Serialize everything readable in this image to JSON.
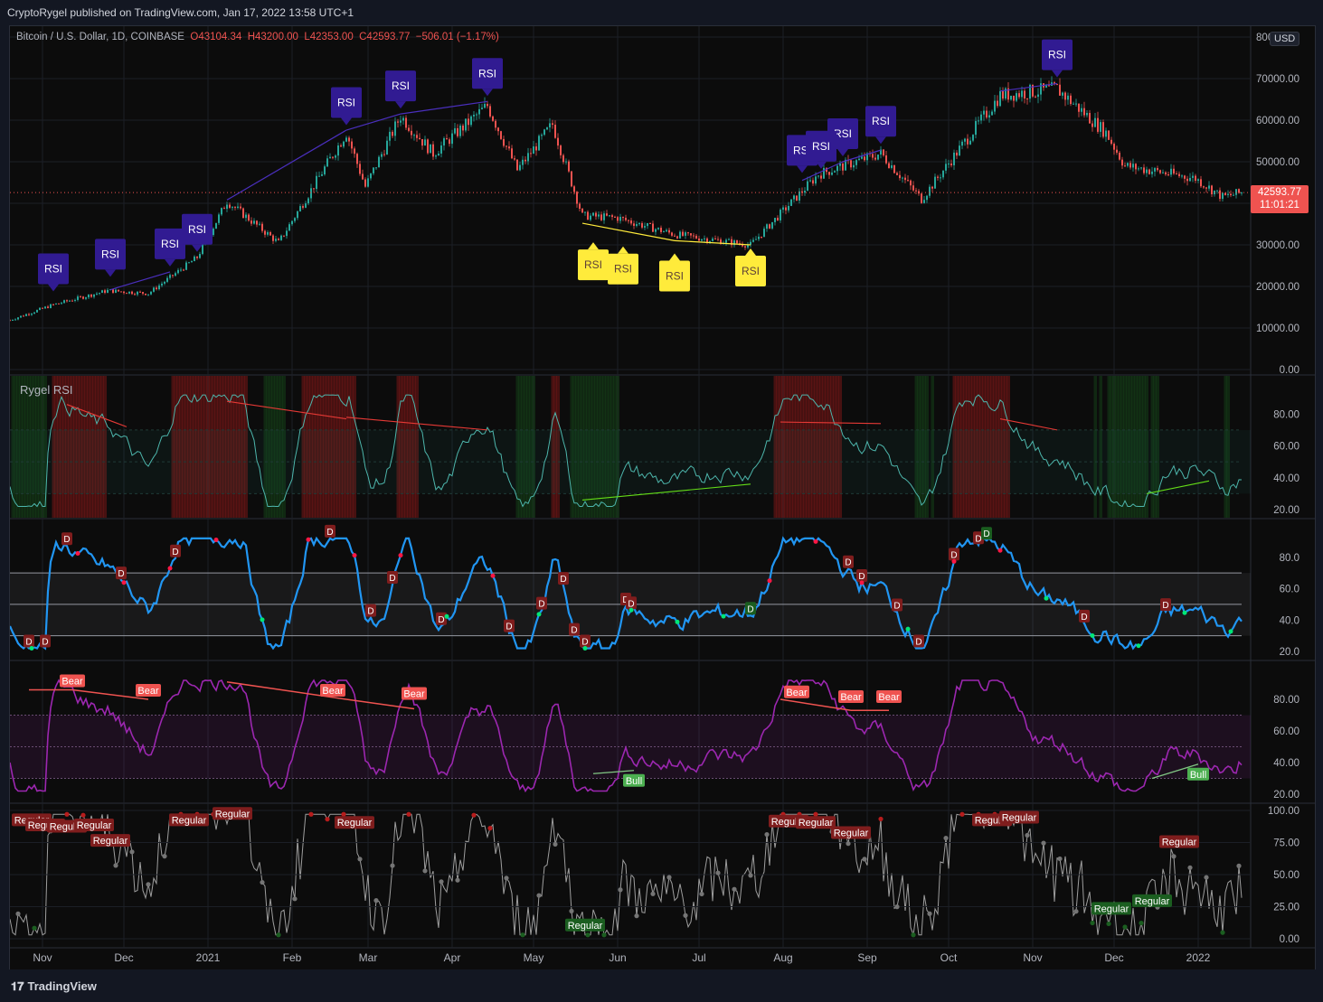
{
  "header": {
    "published": "CryptoRygel published on TradingView.com, Jan 17, 2022 13:58 UTC+1"
  },
  "footer": {
    "brand": "TradingView",
    "brand_icon": "tradingview-logo-icon"
  },
  "legend": {
    "symbol": "Bitcoin / U.S. Dollar, 1D, COINBASE",
    "open": "O43104.34",
    "high": "H43200.00",
    "low": "L42353.00",
    "close": "C42593.77",
    "change": "−506.01 (−1.17%)"
  },
  "price_axis": {
    "currency": "USD",
    "last_price": "42593.77",
    "countdown": "11:01:21"
  },
  "pane2": {
    "title": "Rygel RSI"
  },
  "colors": {
    "background": "#0c0c0c",
    "up": "#26a69a",
    "down": "#ef5350",
    "rsi_badge": "#311b92",
    "rsi_badge_bull": "#ffeb3b",
    "rsi_line_blue": "#2196f3",
    "rsi_line_purple": "#9c27b0",
    "rsi_line_teal": "#4db6ac",
    "rsi_line_grey": "#9e9e9e"
  },
  "chart_data": [
    {
      "type": "candlestick",
      "series": [
        {
          "name": "Bitcoin / U.S. Dollar",
          "approx_close_path": [
            {
              "x": "2020-10-20",
              "y": 11900
            },
            {
              "x": "2020-11-05",
              "y": 15600
            },
            {
              "x": "2020-11-25",
              "y": 19000
            },
            {
              "x": "2020-12-10",
              "y": 18300
            },
            {
              "x": "2020-12-28",
              "y": 27000
            },
            {
              "x": "2021-01-08",
              "y": 40500
            },
            {
              "x": "2021-01-27",
              "y": 30500
            },
            {
              "x": "2021-02-21",
              "y": 57000
            },
            {
              "x": "2021-02-28",
              "y": 44000
            },
            {
              "x": "2021-03-13",
              "y": 61000
            },
            {
              "x": "2021-03-25",
              "y": 52000
            },
            {
              "x": "2021-04-14",
              "y": 63500
            },
            {
              "x": "2021-04-25",
              "y": 48000
            },
            {
              "x": "2021-05-08",
              "y": 59000
            },
            {
              "x": "2021-05-19",
              "y": 37000
            },
            {
              "x": "2021-06-01",
              "y": 36500
            },
            {
              "x": "2021-06-22",
              "y": 32500
            },
            {
              "x": "2021-07-20",
              "y": 30000
            },
            {
              "x": "2021-08-14",
              "y": 47000
            },
            {
              "x": "2021-09-06",
              "y": 52000
            },
            {
              "x": "2021-09-21",
              "y": 41000
            },
            {
              "x": "2021-10-20",
              "y": 66000
            },
            {
              "x": "2021-11-10",
              "y": 67500
            },
            {
              "x": "2021-11-28",
              "y": 57000
            },
            {
              "x": "2021-12-05",
              "y": 49000
            },
            {
              "x": "2021-12-31",
              "y": 46000
            },
            {
              "x": "2022-01-10",
              "y": 41500
            },
            {
              "x": "2022-01-17",
              "y": 42593.77
            }
          ]
        }
      ],
      "y_ticks": [
        "0.00",
        "10000.00",
        "20000.00",
        "30000.00",
        "40000.00",
        "50000.00",
        "60000.00",
        "70000.00",
        "80000.00"
      ],
      "ylim": [
        0,
        80000
      ],
      "annotations": {
        "bear_badges": [
          "RSI",
          "RSI",
          "RSI",
          "RSI",
          "RSI",
          "RSI",
          "RSI",
          "RSI",
          "RSI",
          "RSI",
          "RSI",
          "RSI"
        ],
        "bull_badges": [
          "RSI",
          "RSI",
          "RSI",
          "RSI"
        ]
      }
    },
    {
      "type": "line",
      "name": "Rygel RSI",
      "y_ticks": [
        "20.00",
        "40.00",
        "60.00",
        "80.00"
      ],
      "ylim": [
        20,
        100
      ]
    },
    {
      "type": "line",
      "y_ticks": [
        "20.0",
        "40.0",
        "60.0",
        "80.0"
      ],
      "ylim": [
        20,
        100
      ],
      "levels": [
        30,
        50,
        70
      ],
      "divergence_labels": [
        "D",
        "D",
        "D",
        "D",
        "D",
        "D",
        "D",
        "D",
        "D",
        "D",
        "D",
        "D",
        "D",
        "D",
        "D",
        "D",
        "D",
        "D",
        "D",
        "D",
        "D",
        "D",
        "D",
        "D",
        "D",
        "D"
      ]
    },
    {
      "type": "line",
      "y_ticks": [
        "20.00",
        "40.00",
        "60.00",
        "80.00"
      ],
      "ylim": [
        20,
        100
      ],
      "labels": {
        "bear": "Bear",
        "bull": "Bull"
      }
    },
    {
      "type": "line",
      "y_ticks": [
        "0.00",
        "25.00",
        "50.00",
        "75.00",
        "100.00"
      ],
      "ylim": [
        0,
        100
      ],
      "labels": {
        "regular": "Regular"
      }
    }
  ],
  "x_axis": {
    "labels": [
      "Nov",
      "Dec",
      "2021",
      "Feb",
      "Mar",
      "Apr",
      "May",
      "Jun",
      "Jul",
      "Aug",
      "Sep",
      "Oct",
      "Nov",
      "Dec",
      "2022"
    ]
  }
}
